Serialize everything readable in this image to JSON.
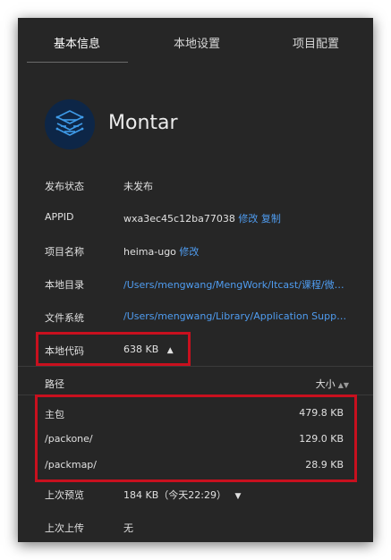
{
  "tabs": [
    {
      "label": "基本信息",
      "active": true
    },
    {
      "label": "本地设置",
      "active": false
    },
    {
      "label": "项目配置",
      "active": false
    }
  ],
  "app": {
    "name": "Montar",
    "logo_color": "#0d2647",
    "logo_icon": "layers-logo-icon"
  },
  "info": {
    "publish_status": {
      "label": "发布状态",
      "value": "未发布"
    },
    "appid": {
      "label": "APPID",
      "value": "wxa3ec45c12ba77038",
      "modify": "修改",
      "copy": "复制"
    },
    "project_name": {
      "label": "项目名称",
      "value": "heima-ugo",
      "modify": "修改"
    },
    "local_dir": {
      "label": "本地目录",
      "value": "/Users/mengwang/MengWork/Itcast/课程/微信小程序/..."
    },
    "file_system": {
      "label": "文件系统",
      "value": "/Users/mengwang/Library/Application Support/..."
    },
    "local_code": {
      "label": "本地代码",
      "value": "638 KB",
      "expand_icon": "chevron-up-icon"
    }
  },
  "packages": {
    "col_path": "路径",
    "col_size": "大小",
    "rows": [
      {
        "path": "主包",
        "size": "479.8 KB"
      },
      {
        "path": "/packone/",
        "size": "129.0 KB"
      },
      {
        "path": "/packmap/",
        "size": "28.9 KB"
      }
    ]
  },
  "last_preview": {
    "label": "上次预览",
    "value": "184 KB（今天22:29）",
    "expand_icon": "chevron-down-icon"
  },
  "last_upload": {
    "label": "上次上传",
    "value": "无"
  },
  "colors": {
    "panel_bg": "#262626",
    "link": "#4f9cf0",
    "highlight": "#c8101e"
  }
}
